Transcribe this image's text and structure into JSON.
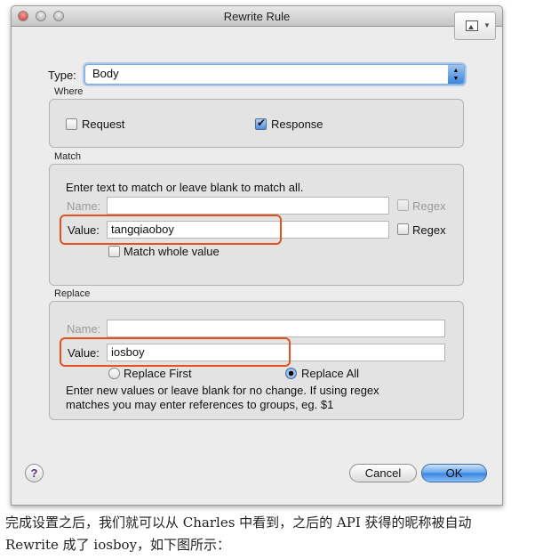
{
  "window": {
    "title": "Rewrite Rule"
  },
  "type_field": {
    "label": "Type:",
    "value": "Body"
  },
  "where": {
    "title": "Where",
    "request": {
      "label": "Request",
      "checked": false
    },
    "response": {
      "label": "Response",
      "checked": true
    }
  },
  "match": {
    "title": "Match",
    "hint": "Enter text to match or leave blank to match all.",
    "name_label": "Name:",
    "name_value": "",
    "name_regex": {
      "label": "Regex",
      "checked": false,
      "enabled": false
    },
    "value_label": "Value:",
    "value_value": "tangqiaoboy",
    "value_regex": {
      "label": "Regex",
      "checked": false
    },
    "whole_value": {
      "label": "Match whole value",
      "checked": false
    }
  },
  "replace": {
    "title": "Replace",
    "name_label": "Name:",
    "name_value": "",
    "value_label": "Value:",
    "value_value": "iosboy",
    "replace_first": {
      "label": "Replace First",
      "selected": false
    },
    "replace_all": {
      "label": "Replace All",
      "selected": true
    },
    "hint_line1": "Enter new values or leave blank for no change. If using regex",
    "hint_line2": "matches you may enter references to groups, eg. $1"
  },
  "buttons": {
    "help": "?",
    "cancel": "Cancel",
    "ok": "OK"
  },
  "caption": {
    "line1": "完成设置之后，我们就可以从 Charles 中看到，之后的 API 获得的昵称被自动",
    "line2": "Rewrite 成了 iosboy，如下图所示："
  },
  "colors": {
    "highlight": "#e0531e",
    "accent": "#3a83df"
  }
}
